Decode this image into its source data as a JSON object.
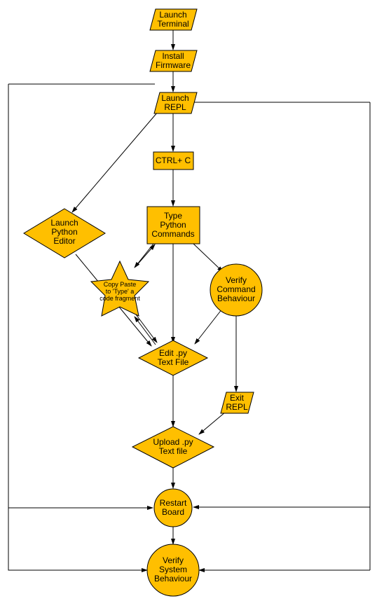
{
  "nodes": {
    "launch_terminal": {
      "line1": "Launch",
      "line2": "Terminal"
    },
    "install_firmware": {
      "line1": "Install",
      "line2": "Firmware"
    },
    "launch_repl": {
      "line1": "Launch",
      "line2": "REPL"
    },
    "ctrl_c": {
      "line1": "CTRL+ C"
    },
    "launch_editor": {
      "line1": "Launch",
      "line2": "Python",
      "line3": "Editor"
    },
    "type_commands": {
      "line1": "Type",
      "line2": "Python",
      "line3": "Commands"
    },
    "copy_paste": {
      "line1": "Copy Paste",
      "line2": "to 'Type' a",
      "line3": "code fragment"
    },
    "verify_command": {
      "line1": "Verify",
      "line2": "Command",
      "line3": "Behaviour"
    },
    "edit_py": {
      "line1": "Edit .py",
      "line2": "Text File"
    },
    "exit_repl": {
      "line1": "Exit",
      "line2": "REPL"
    },
    "upload_py": {
      "line1": "Upload .py",
      "line2": "Text file"
    },
    "restart_board": {
      "line1": "Restart",
      "line2": "Board"
    },
    "verify_system": {
      "line1": "Verify",
      "line2": "System",
      "line3": "Behaviour"
    }
  },
  "colors": {
    "node": "#ffbf00",
    "stroke": "#000000"
  }
}
